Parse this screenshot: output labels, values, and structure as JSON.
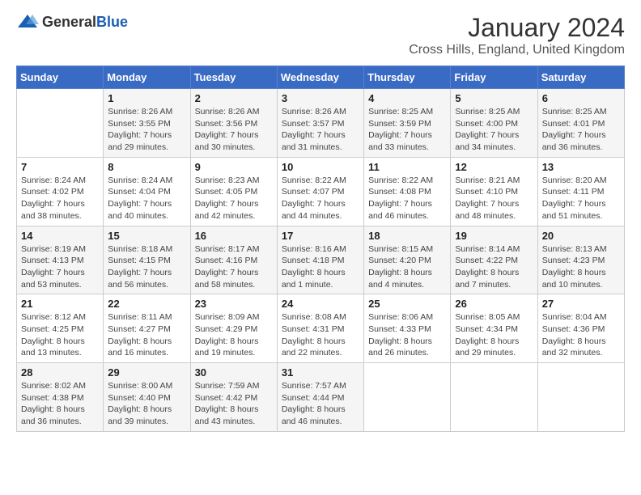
{
  "logo": {
    "text_general": "General",
    "text_blue": "Blue"
  },
  "header": {
    "month_year": "January 2024",
    "location": "Cross Hills, England, United Kingdom"
  },
  "weekdays": [
    "Sunday",
    "Monday",
    "Tuesday",
    "Wednesday",
    "Thursday",
    "Friday",
    "Saturday"
  ],
  "weeks": [
    [
      {
        "day": "",
        "sunrise": "",
        "sunset": "",
        "daylight": ""
      },
      {
        "day": "1",
        "sunrise": "Sunrise: 8:26 AM",
        "sunset": "Sunset: 3:55 PM",
        "daylight": "Daylight: 7 hours and 29 minutes."
      },
      {
        "day": "2",
        "sunrise": "Sunrise: 8:26 AM",
        "sunset": "Sunset: 3:56 PM",
        "daylight": "Daylight: 7 hours and 30 minutes."
      },
      {
        "day": "3",
        "sunrise": "Sunrise: 8:26 AM",
        "sunset": "Sunset: 3:57 PM",
        "daylight": "Daylight: 7 hours and 31 minutes."
      },
      {
        "day": "4",
        "sunrise": "Sunrise: 8:25 AM",
        "sunset": "Sunset: 3:59 PM",
        "daylight": "Daylight: 7 hours and 33 minutes."
      },
      {
        "day": "5",
        "sunrise": "Sunrise: 8:25 AM",
        "sunset": "Sunset: 4:00 PM",
        "daylight": "Daylight: 7 hours and 34 minutes."
      },
      {
        "day": "6",
        "sunrise": "Sunrise: 8:25 AM",
        "sunset": "Sunset: 4:01 PM",
        "daylight": "Daylight: 7 hours and 36 minutes."
      }
    ],
    [
      {
        "day": "7",
        "sunrise": "Sunrise: 8:24 AM",
        "sunset": "Sunset: 4:02 PM",
        "daylight": "Daylight: 7 hours and 38 minutes."
      },
      {
        "day": "8",
        "sunrise": "Sunrise: 8:24 AM",
        "sunset": "Sunset: 4:04 PM",
        "daylight": "Daylight: 7 hours and 40 minutes."
      },
      {
        "day": "9",
        "sunrise": "Sunrise: 8:23 AM",
        "sunset": "Sunset: 4:05 PM",
        "daylight": "Daylight: 7 hours and 42 minutes."
      },
      {
        "day": "10",
        "sunrise": "Sunrise: 8:22 AM",
        "sunset": "Sunset: 4:07 PM",
        "daylight": "Daylight: 7 hours and 44 minutes."
      },
      {
        "day": "11",
        "sunrise": "Sunrise: 8:22 AM",
        "sunset": "Sunset: 4:08 PM",
        "daylight": "Daylight: 7 hours and 46 minutes."
      },
      {
        "day": "12",
        "sunrise": "Sunrise: 8:21 AM",
        "sunset": "Sunset: 4:10 PM",
        "daylight": "Daylight: 7 hours and 48 minutes."
      },
      {
        "day": "13",
        "sunrise": "Sunrise: 8:20 AM",
        "sunset": "Sunset: 4:11 PM",
        "daylight": "Daylight: 7 hours and 51 minutes."
      }
    ],
    [
      {
        "day": "14",
        "sunrise": "Sunrise: 8:19 AM",
        "sunset": "Sunset: 4:13 PM",
        "daylight": "Daylight: 7 hours and 53 minutes."
      },
      {
        "day": "15",
        "sunrise": "Sunrise: 8:18 AM",
        "sunset": "Sunset: 4:15 PM",
        "daylight": "Daylight: 7 hours and 56 minutes."
      },
      {
        "day": "16",
        "sunrise": "Sunrise: 8:17 AM",
        "sunset": "Sunset: 4:16 PM",
        "daylight": "Daylight: 7 hours and 58 minutes."
      },
      {
        "day": "17",
        "sunrise": "Sunrise: 8:16 AM",
        "sunset": "Sunset: 4:18 PM",
        "daylight": "Daylight: 8 hours and 1 minute."
      },
      {
        "day": "18",
        "sunrise": "Sunrise: 8:15 AM",
        "sunset": "Sunset: 4:20 PM",
        "daylight": "Daylight: 8 hours and 4 minutes."
      },
      {
        "day": "19",
        "sunrise": "Sunrise: 8:14 AM",
        "sunset": "Sunset: 4:22 PM",
        "daylight": "Daylight: 8 hours and 7 minutes."
      },
      {
        "day": "20",
        "sunrise": "Sunrise: 8:13 AM",
        "sunset": "Sunset: 4:23 PM",
        "daylight": "Daylight: 8 hours and 10 minutes."
      }
    ],
    [
      {
        "day": "21",
        "sunrise": "Sunrise: 8:12 AM",
        "sunset": "Sunset: 4:25 PM",
        "daylight": "Daylight: 8 hours and 13 minutes."
      },
      {
        "day": "22",
        "sunrise": "Sunrise: 8:11 AM",
        "sunset": "Sunset: 4:27 PM",
        "daylight": "Daylight: 8 hours and 16 minutes."
      },
      {
        "day": "23",
        "sunrise": "Sunrise: 8:09 AM",
        "sunset": "Sunset: 4:29 PM",
        "daylight": "Daylight: 8 hours and 19 minutes."
      },
      {
        "day": "24",
        "sunrise": "Sunrise: 8:08 AM",
        "sunset": "Sunset: 4:31 PM",
        "daylight": "Daylight: 8 hours and 22 minutes."
      },
      {
        "day": "25",
        "sunrise": "Sunrise: 8:06 AM",
        "sunset": "Sunset: 4:33 PM",
        "daylight": "Daylight: 8 hours and 26 minutes."
      },
      {
        "day": "26",
        "sunrise": "Sunrise: 8:05 AM",
        "sunset": "Sunset: 4:34 PM",
        "daylight": "Daylight: 8 hours and 29 minutes."
      },
      {
        "day": "27",
        "sunrise": "Sunrise: 8:04 AM",
        "sunset": "Sunset: 4:36 PM",
        "daylight": "Daylight: 8 hours and 32 minutes."
      }
    ],
    [
      {
        "day": "28",
        "sunrise": "Sunrise: 8:02 AM",
        "sunset": "Sunset: 4:38 PM",
        "daylight": "Daylight: 8 hours and 36 minutes."
      },
      {
        "day": "29",
        "sunrise": "Sunrise: 8:00 AM",
        "sunset": "Sunset: 4:40 PM",
        "daylight": "Daylight: 8 hours and 39 minutes."
      },
      {
        "day": "30",
        "sunrise": "Sunrise: 7:59 AM",
        "sunset": "Sunset: 4:42 PM",
        "daylight": "Daylight: 8 hours and 43 minutes."
      },
      {
        "day": "31",
        "sunrise": "Sunrise: 7:57 AM",
        "sunset": "Sunset: 4:44 PM",
        "daylight": "Daylight: 8 hours and 46 minutes."
      },
      {
        "day": "",
        "sunrise": "",
        "sunset": "",
        "daylight": ""
      },
      {
        "day": "",
        "sunrise": "",
        "sunset": "",
        "daylight": ""
      },
      {
        "day": "",
        "sunrise": "",
        "sunset": "",
        "daylight": ""
      }
    ]
  ]
}
